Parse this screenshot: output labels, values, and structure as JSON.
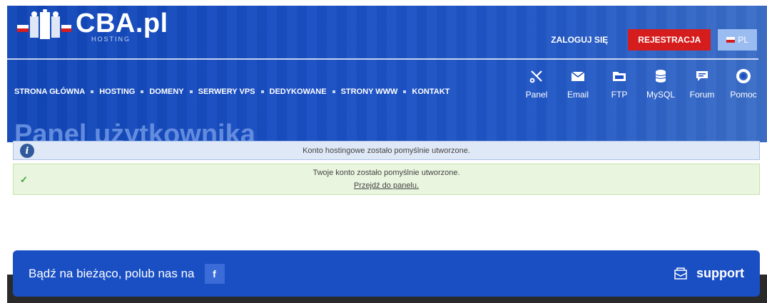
{
  "header": {
    "logo_text": "CBA.pl",
    "logo_sub": "HOSTING",
    "login_label": "ZALOGUJ SIĘ",
    "register_label": "REJESTRACJA",
    "lang_label": "PL",
    "page_title": "Panel użytkownika"
  },
  "main_nav": [
    "STRONA GŁÓWNA",
    "HOSTING",
    "DOMENY",
    "SERWERY VPS",
    "DEDYKOWANE",
    "STRONY WWW",
    "KONTAKT"
  ],
  "icon_nav": [
    {
      "label": "Panel",
      "icon": "tools-icon"
    },
    {
      "label": "Email",
      "icon": "mail-icon"
    },
    {
      "label": "FTP",
      "icon": "ftp-folder-icon"
    },
    {
      "label": "MySQL",
      "icon": "database-icon"
    },
    {
      "label": "Forum",
      "icon": "chat-icon"
    },
    {
      "label": "Pomoc",
      "icon": "lifebuoy-icon"
    }
  ],
  "alerts": {
    "info_text": "Konto hostingowe zostało pomyślnie utworzone.",
    "success_text": "Twoje konto zostało pomyślnie utworzone.",
    "success_link": "Przejdź do panelu."
  },
  "footer": {
    "follow_text": "Bądź na bieżąco, polub nas na",
    "fb_label": "f",
    "support_label": "support"
  },
  "colors": {
    "brand_blue": "#1a4fc4",
    "register_red": "#d61d1d",
    "info_bg": "#dfe8f6",
    "success_bg": "#eaf5df"
  }
}
